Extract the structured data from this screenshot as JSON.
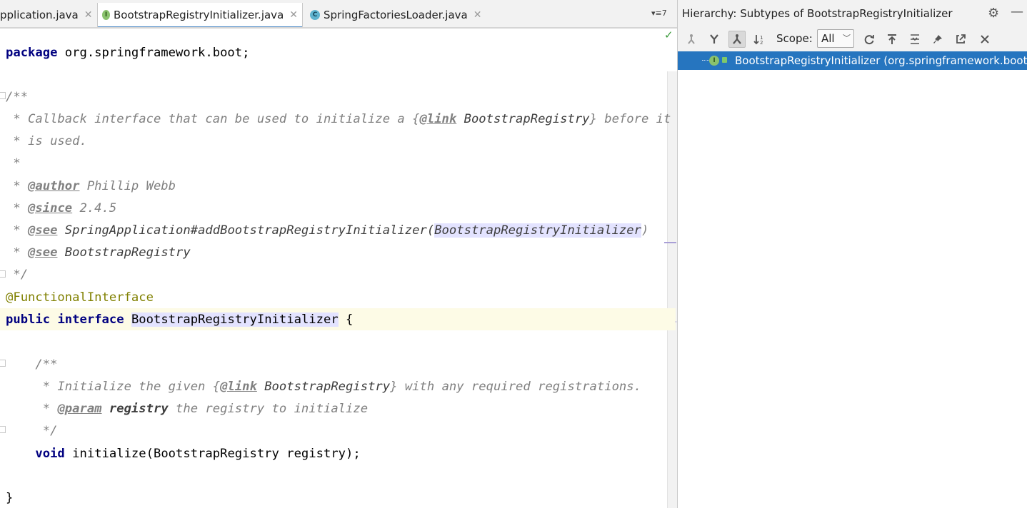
{
  "tabs": [
    {
      "label": "pplication.java",
      "icon": "",
      "active": false
    },
    {
      "label": "BootstrapRegistryInitializer.java",
      "icon": "I",
      "active": true
    },
    {
      "label": "SpringFactoriesLoader.java",
      "icon": "C",
      "active": false
    }
  ],
  "tab_close_glyph": "✕",
  "tab_overflow": "▾≡7",
  "editor": {
    "status_check": "✓",
    "code": {
      "package_kw": "package",
      "package_name": " org.springframework.boot;",
      "doc_open": "/**",
      "doc_line1_a": " * Callback interface that can be used to initialize a ",
      "link_open": "{",
      "link_tag": "@link",
      "link_ref": " BootstrapRegistry",
      "link_close": "}",
      "doc_line1_b": " before it",
      "doc_line2": " * is used.",
      "doc_star": " *",
      "star_prefix": " * ",
      "author_tag": "@author",
      "author_val": " Phillip Webb",
      "since_tag": "@since",
      "since_val": " 2.4.5",
      "see_tag": "@see",
      "see1_ref": " SpringApplication#addBootstrapRegistryInitializer(",
      "see1_param": "BootstrapRegistryInitializer",
      "see1_close": ")",
      "see2_ref": " BootstrapRegistry",
      "doc_close": " */",
      "annotation": "@FunctionalInterface",
      "public_kw": "public",
      "interface_kw": "interface",
      "interface_name": "BootstrapRegistryInitializer",
      "brace_open": " {",
      "m_doc_open": "    /**",
      "m_doc_prefix": "     * Initialize the given ",
      "m_link_open": "{",
      "m_link_tag": "@link",
      "m_link_ref": " BootstrapRegistry",
      "m_link_close": "}",
      "m_doc_tail": " with any required registrations.",
      "m_param_prefix": "     * ",
      "param_tag": "@param",
      "param_name": " registry",
      "param_desc": " the registry to initialize",
      "m_doc_close": "     */",
      "void_kw": "    void",
      "method_sig": " initialize(BootstrapRegistry registry);",
      "brace_close": "}"
    }
  },
  "hierarchy": {
    "title": "Hierarchy:  Subtypes of BootstrapRegistryInitializer",
    "scope_label": "Scope:",
    "scope_value": "All",
    "node_icon": "I",
    "node_label": "BootstrapRegistryInitializer (org.springframework.boot)"
  },
  "colors": {
    "selection": "#2675bf",
    "keyword": "#000080",
    "annotation": "#808000",
    "comment": "#808080"
  }
}
